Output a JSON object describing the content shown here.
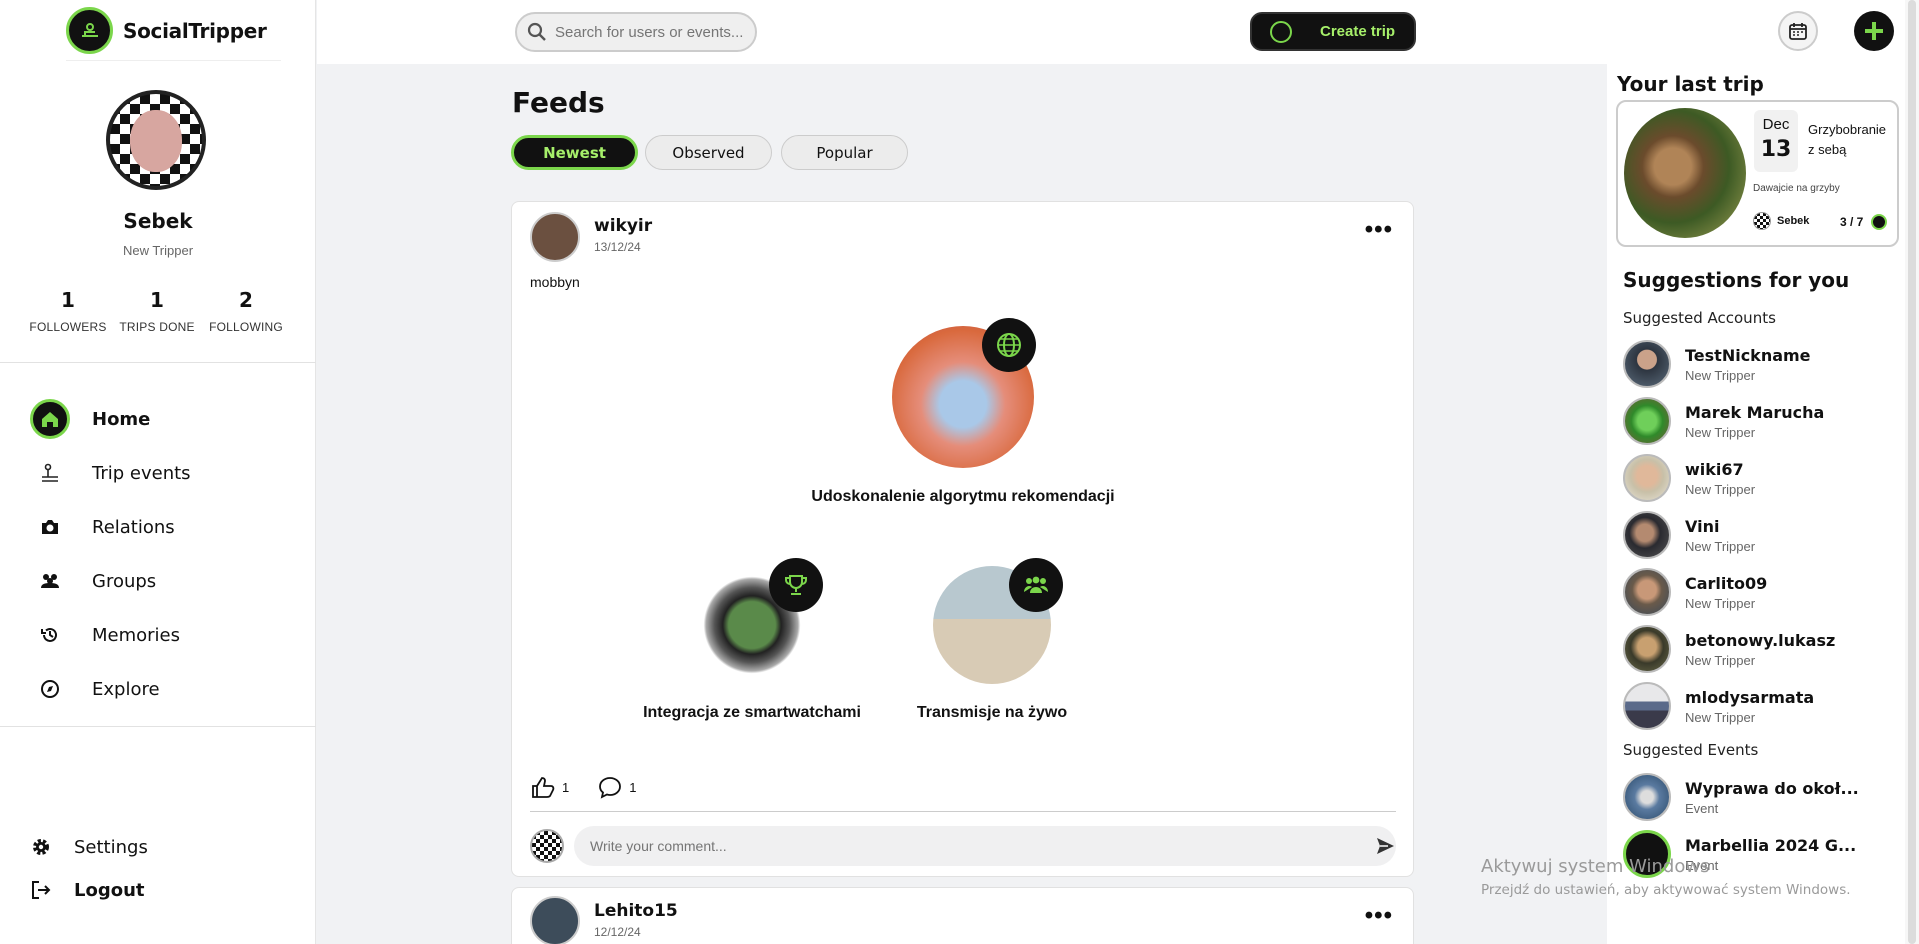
{
  "brand": {
    "name": "SocialTripper"
  },
  "profile": {
    "name": "Sebek",
    "role": "New Tripper",
    "stats": [
      {
        "value": "1",
        "label": "FOLLOWERS"
      },
      {
        "value": "1",
        "label": "TRIPS DONE"
      },
      {
        "value": "2",
        "label": "FOLLOWING"
      }
    ]
  },
  "nav": [
    {
      "label": "Home",
      "icon": "home-icon"
    },
    {
      "label": "Trip events",
      "icon": "trip-events-icon"
    },
    {
      "label": "Relations",
      "icon": "camera-icon"
    },
    {
      "label": "Groups",
      "icon": "users-icon"
    },
    {
      "label": "Memories",
      "icon": "history-icon"
    },
    {
      "label": "Explore",
      "icon": "compass-icon"
    }
  ],
  "bottom_nav": {
    "settings": "Settings",
    "logout": "Logout"
  },
  "search": {
    "placeholder": "Search for users or events..."
  },
  "create_trip": "Create trip",
  "feed": {
    "title": "Feeds",
    "tabs": [
      "Newest",
      "Observed",
      "Popular"
    ],
    "posts": [
      {
        "author": "wikyir",
        "date": "13/12/24",
        "text": "mobbyn",
        "features": [
          {
            "title": "Udoskonalenie algorytmu rekomendacji",
            "badge": "globe-icon"
          },
          {
            "title": "Integracja ze smartwatchami",
            "badge": "trophy-icon"
          },
          {
            "title": "Transmisje na żywo",
            "badge": "group-icon"
          }
        ],
        "likes": "1",
        "comments": "1",
        "comment_placeholder": "Write your comment..."
      },
      {
        "author": "Lehito15",
        "date": "12/12/24"
      }
    ]
  },
  "last_trip": {
    "title": "Your last trip",
    "month": "Dec",
    "day": "13",
    "name": "Grzybobranie z sebą",
    "description": "Dawajcie na grzyby",
    "owner": "Sebek",
    "participants": "3 / 7"
  },
  "suggestions": {
    "title": "Suggestions for you",
    "accounts_title": "Suggested Accounts",
    "accounts": [
      {
        "name": "TestNickname",
        "role": "New Tripper"
      },
      {
        "name": "Marek Marucha",
        "role": "New Tripper"
      },
      {
        "name": "wiki67",
        "role": "New Tripper"
      },
      {
        "name": "Vini",
        "role": "New Tripper"
      },
      {
        "name": "Carlito09",
        "role": "New Tripper"
      },
      {
        "name": "betonowy.lukasz",
        "role": "New Tripper"
      },
      {
        "name": "mlodysarmata",
        "role": "New Tripper"
      }
    ],
    "events_title": "Suggested Events",
    "events": [
      {
        "name": "Wyprawa do okoł...",
        "role": "Event"
      },
      {
        "name": "Marbellia 2024 G...",
        "role": "Event"
      }
    ]
  },
  "watermark": {
    "line1": "Aktywuj system Windows",
    "line2": "Przejdź do ustawień, aby aktywować system Windows."
  },
  "colors": {
    "accent": "#7bd64b",
    "dark": "#111111"
  }
}
